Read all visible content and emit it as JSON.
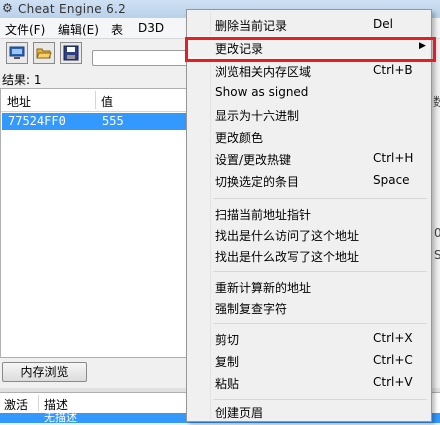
{
  "window": {
    "title": "Cheat Engine 6.2"
  },
  "menubar": {
    "items": [
      "文件(F)",
      "编辑(E)",
      "表",
      "D3D"
    ]
  },
  "scan": {
    "results_label": "结果: 1"
  },
  "results": {
    "headers": [
      "地址",
      "值"
    ],
    "rows": [
      {
        "address": "77524FF0",
        "value": "555"
      }
    ]
  },
  "memory_view_button": "内存浏览",
  "address_list": {
    "headers": [
      "激活",
      "描述"
    ],
    "row_text": "无描述"
  },
  "right_fragments": {
    "a": "数",
    "b": "0",
    "c": "S"
  },
  "context_menu": {
    "groups": [
      [
        {
          "label": "删除当前记录",
          "shortcut": "Del"
        },
        {
          "label": "更改记录",
          "submenu": true,
          "highlighted": true
        },
        {
          "label": "浏览相关内存区域",
          "shortcut": "Ctrl+B"
        },
        {
          "label": "Show as signed",
          "shortcut": ""
        },
        {
          "label": "显示为十六进制",
          "shortcut": ""
        },
        {
          "label": "更改颜色",
          "shortcut": ""
        },
        {
          "label": "设置/更改热键",
          "shortcut": "Ctrl+H"
        },
        {
          "label": "切换选定的条目",
          "shortcut": "Space"
        }
      ],
      [
        {
          "label": "扫描当前地址指针",
          "shortcut": ""
        },
        {
          "label": "找出是什么访问了这个地址",
          "shortcut": ""
        },
        {
          "label": "找出是什么改写了这个地址",
          "shortcut": ""
        }
      ],
      [
        {
          "label": "重新计算新的地址",
          "shortcut": ""
        },
        {
          "label": "强制复查字符",
          "shortcut": ""
        }
      ],
      [
        {
          "label": "剪切",
          "shortcut": "Ctrl+X"
        },
        {
          "label": "复制",
          "shortcut": "Ctrl+C"
        },
        {
          "label": "粘贴",
          "shortcut": "Ctrl+V"
        }
      ],
      [
        {
          "label": "创建页眉",
          "shortcut": ""
        }
      ]
    ]
  },
  "colors": {
    "selection": "#3399ff",
    "highlight_outline": "#e51e25"
  }
}
